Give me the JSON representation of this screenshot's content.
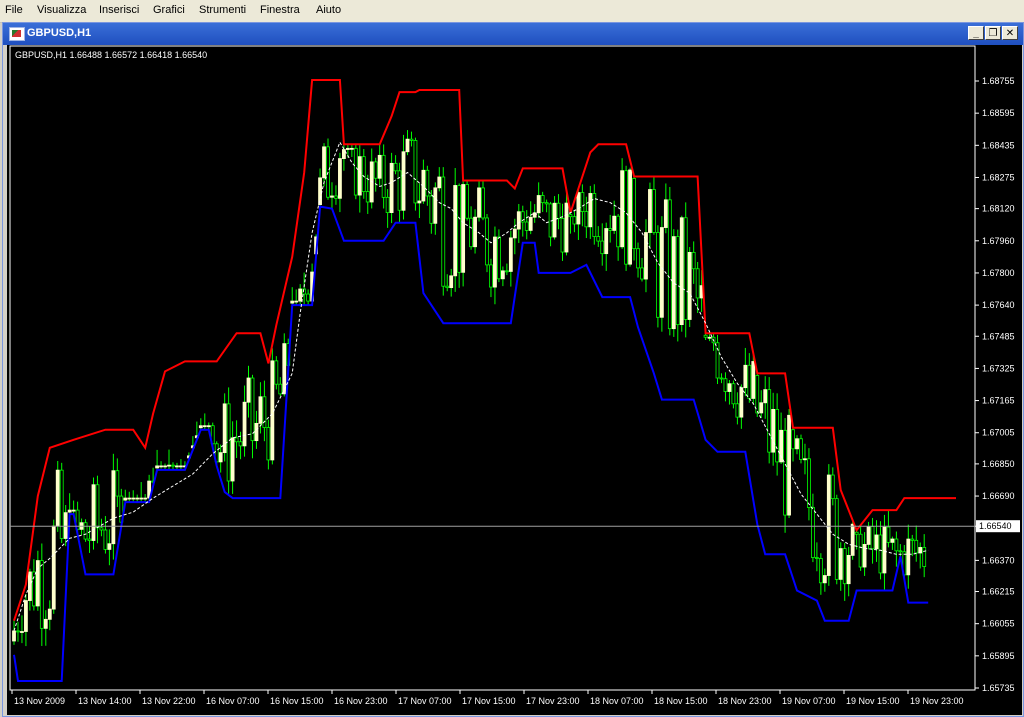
{
  "menubar": {
    "items": [
      "File",
      "Visualizza",
      "Inserisci",
      "Grafici",
      "Strumenti",
      "Finestra",
      "Aiuto"
    ]
  },
  "window": {
    "title": "GBPUSD,H1",
    "minimize_glyph": "_",
    "restore_glyph": "❐",
    "close_glyph": "✕"
  },
  "chart_info": "GBPUSD,H1  1.66488 1.66572 1.66418 1.66540",
  "colors": {
    "background": "#000000",
    "upper_band": "#ff0000",
    "lower_band": "#0000ff",
    "middle_line": "#ffffff",
    "bull_candle": "#ffffcc",
    "candle_wick": "#00ff00",
    "axis": "#ffffff"
  },
  "chart_data": {
    "type": "candlestick",
    "symbol": "GBPUSD",
    "timeframe": "H1",
    "current_price": "1.66540",
    "y_ticks": [
      "1.68755",
      "1.68595",
      "1.68435",
      "1.68275",
      "1.68120",
      "1.67960",
      "1.67800",
      "1.67640",
      "1.67485",
      "1.67325",
      "1.67165",
      "1.67005",
      "1.66850",
      "1.66690",
      "1.66540",
      "1.66370",
      "1.66215",
      "1.66055",
      "1.65895",
      "1.65735"
    ],
    "x_ticks": [
      "13 Nov 2009",
      "13 Nov 14:00",
      "13 Nov 22:00",
      "16 Nov 07:00",
      "16 Nov 15:00",
      "16 Nov 23:00",
      "17 Nov 07:00",
      "17 Nov 15:00",
      "17 Nov 23:00",
      "18 Nov 07:00",
      "18 Nov 15:00",
      "18 Nov 23:00",
      "19 Nov 07:00",
      "19 Nov 15:00",
      "19 Nov 23:00"
    ],
    "ylim": [
      1.6566,
      1.6892
    ],
    "upper_band": [
      1.6605,
      1.661,
      1.6625,
      1.666,
      1.6688,
      1.6693,
      1.6695,
      1.6695,
      1.6697,
      1.67,
      1.67,
      1.67,
      1.67,
      1.67,
      1.67,
      1.67,
      1.67,
      1.67,
      1.67,
      1.67,
      1.67,
      1.6702,
      1.6702,
      1.6702,
      1.6702,
      1.6702,
      1.6702,
      1.6702,
      1.6697,
      1.6693,
      1.6707,
      1.6722,
      1.673,
      1.6732,
      1.6732,
      1.6732,
      1.6732,
      1.6732,
      1.6732,
      1.6732,
      1.6732,
      1.6732,
      1.6732,
      1.6732,
      1.6732,
      1.6732,
      1.6732,
      1.6737,
      1.6737,
      1.6737,
      1.6737,
      1.6737,
      1.6737,
      1.6737,
      1.6737,
      1.6737,
      1.6737,
      1.6737,
      1.6737,
      1.6737,
      1.673,
      1.6735,
      1.6752,
      1.677,
      1.6788,
      1.6805,
      1.6815,
      1.683,
      1.6848,
      1.6876,
      1.6876,
      1.6876,
      1.6876,
      1.6876,
      1.6876,
      1.6876,
      1.6876,
      1.6876,
      1.6876,
      1.6848,
      1.6848,
      1.6848,
      1.6848,
      1.6848,
      1.6848,
      1.6848,
      1.6848,
      1.6848,
      1.6848,
      1.6848,
      1.6848,
      1.6848,
      1.6848,
      1.6858,
      1.6866,
      1.6866,
      1.6866,
      1.6871,
      1.6871,
      1.6871,
      1.6871,
      1.6871,
      1.6871,
      1.6871,
      1.6871,
      1.6871,
      1.6871,
      1.6871,
      1.6871,
      1.6871,
      1.6871,
      1.6871,
      1.6826,
      1.6826,
      1.6826,
      1.6826,
      1.6826,
      1.6826,
      1.6826,
      1.6826,
      1.6826,
      1.6826,
      1.6826,
      1.6826,
      1.6824,
      1.6822,
      1.6832,
      1.6832,
      1.6832,
      1.6832,
      1.6832,
      1.6832,
      1.6832,
      1.6832,
      1.6832,
      1.6832,
      1.6832,
      1.6832,
      1.682,
      1.681,
      1.682,
      1.6835,
      1.684,
      1.6845,
      1.6848,
      1.6848,
      1.6848,
      1.6848,
      1.6848,
      1.6848,
      1.6848,
      1.6848,
      1.6848,
      1.6848,
      1.6828,
      1.6828,
      1.6828,
      1.6828,
      1.6828,
      1.6828,
      1.6828,
      1.6828,
      1.6828,
      1.6828,
      1.6828,
      1.6828,
      1.6828,
      1.6828,
      1.6828,
      1.6828,
      1.6828,
      1.6828,
      1.6828,
      1.6828,
      1.676,
      1.676,
      1.676,
      1.676,
      1.676,
      1.676,
      1.676,
      1.676,
      1.676,
      1.676,
      1.676,
      1.676,
      1.676,
      1.676,
      1.676,
      1.6737,
      1.6737,
      1.6737,
      1.6737,
      1.6737,
      1.6737,
      1.6737,
      1.6737,
      1.6737,
      1.6737,
      1.6737,
      1.6737,
      1.6737,
      1.6737,
      1.6737,
      1.6737,
      1.6737,
      1.6737,
      1.6737,
      1.6737,
      1.6737,
      1.6737,
      1.6737,
      1.6737,
      1.6737,
      1.6737,
      1.6737,
      1.6737,
      1.6737,
      1.6737,
      1.6737,
      1.6737,
      1.6737,
      1.6737,
      1.6737,
      1.6737,
      1.6737,
      1.6737,
      1.6737,
      1.6737,
      1.6737,
      1.6737,
      1.6737,
      1.6737,
      1.6737,
      1.6737,
      1.6737,
      1.6737,
      1.6737,
      1.6737,
      1.6737,
      1.6737,
      1.6737,
      1.6737,
      1.6737,
      1.6737
    ],
    "upper_path": [
      [
        0,
        1.6607
      ],
      [
        3,
        1.6625
      ],
      [
        6,
        1.6669
      ],
      [
        9,
        1.6693
      ],
      [
        15,
        1.6697
      ],
      [
        23,
        1.6702
      ],
      [
        30,
        1.6702
      ],
      [
        33,
        1.6693
      ],
      [
        35,
        1.671
      ],
      [
        38,
        1.6731
      ],
      [
        43,
        1.6736
      ],
      [
        51,
        1.6736
      ],
      [
        56,
        1.675
      ],
      [
        62,
        1.675
      ],
      [
        64,
        1.6735
      ],
      [
        66,
        1.6754
      ],
      [
        70,
        1.6788
      ],
      [
        73,
        1.683
      ],
      [
        75,
        1.6876
      ],
      [
        82,
        1.6876
      ],
      [
        83,
        1.6844
      ],
      [
        92,
        1.6844
      ],
      [
        95,
        1.6858
      ],
      [
        97,
        1.687
      ],
      [
        101,
        1.687
      ],
      [
        102,
        1.6871
      ],
      [
        112,
        1.6871
      ],
      [
        113,
        1.6826
      ],
      [
        124,
        1.6826
      ],
      [
        126,
        1.6822
      ],
      [
        128,
        1.6832
      ],
      [
        138,
        1.6832
      ],
      [
        140,
        1.681
      ],
      [
        145,
        1.684
      ],
      [
        147,
        1.6844
      ],
      [
        154,
        1.6844
      ],
      [
        156,
        1.6828
      ],
      [
        172,
        1.6828
      ],
      [
        174,
        1.675
      ],
      [
        185,
        1.675
      ],
      [
        187,
        1.673
      ],
      [
        194,
        1.673
      ],
      [
        196,
        1.6703
      ],
      [
        206,
        1.6703
      ],
      [
        208,
        1.6672
      ],
      [
        212,
        1.6652
      ],
      [
        216,
        1.6662
      ],
      [
        222,
        1.6662
      ],
      [
        224,
        1.6668
      ],
      [
        237,
        1.6668
      ]
    ],
    "lower_path": [
      [
        0,
        1.659
      ],
      [
        1,
        1.6577
      ],
      [
        12,
        1.6577
      ],
      [
        14,
        1.666
      ],
      [
        15,
        1.666
      ],
      [
        18,
        1.663
      ],
      [
        25,
        1.663
      ],
      [
        28,
        1.6666
      ],
      [
        34,
        1.6666
      ],
      [
        36,
        1.6682
      ],
      [
        43,
        1.6682
      ],
      [
        47,
        1.6702
      ],
      [
        49,
        1.6702
      ],
      [
        51,
        1.6684
      ],
      [
        53,
        1.6671
      ],
      [
        55,
        1.6668
      ],
      [
        67,
        1.6668
      ],
      [
        70,
        1.6764
      ],
      [
        75,
        1.6764
      ],
      [
        77,
        1.6813
      ],
      [
        80,
        1.6812
      ],
      [
        83,
        1.6796
      ],
      [
        93,
        1.6796
      ],
      [
        96,
        1.6805
      ],
      [
        101,
        1.6805
      ],
      [
        103,
        1.677
      ],
      [
        108,
        1.6755
      ],
      [
        125,
        1.6755
      ],
      [
        128,
        1.6795
      ],
      [
        131,
        1.6795
      ],
      [
        132,
        1.678
      ],
      [
        140,
        1.678
      ],
      [
        144,
        1.6784
      ],
      [
        148,
        1.6768
      ],
      [
        155,
        1.6768
      ],
      [
        157,
        1.6753
      ],
      [
        161,
        1.673
      ],
      [
        163,
        1.6717
      ],
      [
        171,
        1.6717
      ],
      [
        174,
        1.6697
      ],
      [
        177,
        1.6691
      ],
      [
        184,
        1.6691
      ],
      [
        187,
        1.6655
      ],
      [
        189,
        1.664
      ],
      [
        194,
        1.664
      ],
      [
        197,
        1.6622
      ],
      [
        202,
        1.6617
      ],
      [
        204,
        1.6607
      ],
      [
        210,
        1.6607
      ],
      [
        212,
        1.6622
      ],
      [
        221,
        1.6622
      ],
      [
        223,
        1.6639
      ],
      [
        225,
        1.6616
      ],
      [
        230,
        1.6616
      ]
    ],
    "mid_path": [
      [
        0,
        1.6602
      ],
      [
        3,
        1.662
      ],
      [
        6,
        1.6633
      ],
      [
        9,
        1.6638
      ],
      [
        14,
        1.6648
      ],
      [
        18,
        1.665
      ],
      [
        25,
        1.6658
      ],
      [
        30,
        1.6661
      ],
      [
        35,
        1.6668
      ],
      [
        40,
        1.6674
      ],
      [
        45,
        1.668
      ],
      [
        50,
        1.669
      ],
      [
        55,
        1.6698
      ],
      [
        60,
        1.67
      ],
      [
        65,
        1.671
      ],
      [
        70,
        1.673
      ],
      [
        72,
        1.676
      ],
      [
        75,
        1.68
      ],
      [
        78,
        1.6825
      ],
      [
        82,
        1.6845
      ],
      [
        85,
        1.6835
      ],
      [
        88,
        1.6828
      ],
      [
        92,
        1.6823
      ],
      [
        95,
        1.6825
      ],
      [
        99,
        1.683
      ],
      [
        103,
        1.6823
      ],
      [
        107,
        1.6815
      ],
      [
        110,
        1.6812
      ],
      [
        113,
        1.6805
      ],
      [
        117,
        1.68
      ],
      [
        120,
        1.6795
      ],
      [
        124,
        1.68
      ],
      [
        127,
        1.6805
      ],
      [
        131,
        1.681
      ],
      [
        134,
        1.6805
      ],
      [
        138,
        1.6808
      ],
      [
        142,
        1.6812
      ],
      [
        146,
        1.6817
      ],
      [
        150,
        1.6815
      ],
      [
        154,
        1.681
      ],
      [
        158,
        1.68
      ],
      [
        162,
        1.6785
      ],
      [
        166,
        1.6775
      ],
      [
        170,
        1.677
      ],
      [
        174,
        1.6755
      ],
      [
        178,
        1.6738
      ],
      [
        182,
        1.6725
      ],
      [
        186,
        1.6715
      ],
      [
        190,
        1.67
      ],
      [
        194,
        1.6685
      ],
      [
        198,
        1.667
      ],
      [
        202,
        1.666
      ],
      [
        206,
        1.665
      ],
      [
        210,
        1.6645
      ],
      [
        214,
        1.6643
      ],
      [
        218,
        1.6642
      ],
      [
        222,
        1.664
      ],
      [
        226,
        1.664
      ],
      [
        230,
        1.6642
      ]
    ],
    "candles_seed_note": "",
    "n_bars": 238
  }
}
